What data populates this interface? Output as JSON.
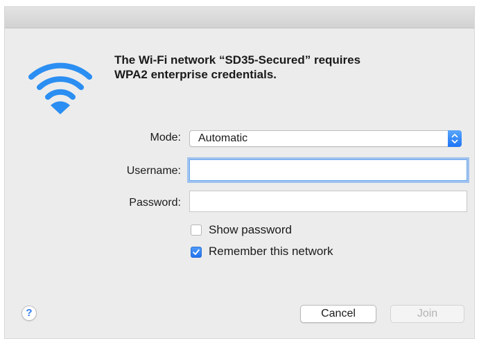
{
  "dialog": {
    "message_line1": "The Wi-Fi network “SD35-Secured” requires",
    "message_line2": "WPA2 enterprise credentials."
  },
  "form": {
    "mode_label": "Mode:",
    "mode_value": "Automatic",
    "username_label": "Username:",
    "username_value": "",
    "password_label": "Password:",
    "password_value": ""
  },
  "options": {
    "show_password_label": "Show password",
    "show_password_checked": false,
    "remember_label": "Remember this network",
    "remember_checked": true
  },
  "buttons": {
    "help_label": "?",
    "cancel_label": "Cancel",
    "join_label": "Join"
  },
  "icons": {
    "wifi": "wifi-icon",
    "stepper": "chevron-updown-icon",
    "check": "checkmark-icon"
  },
  "colors": {
    "accent": "#1f7bf2",
    "wifi": "#2b8ef2",
    "disabled_text": "#b3b3b3"
  }
}
